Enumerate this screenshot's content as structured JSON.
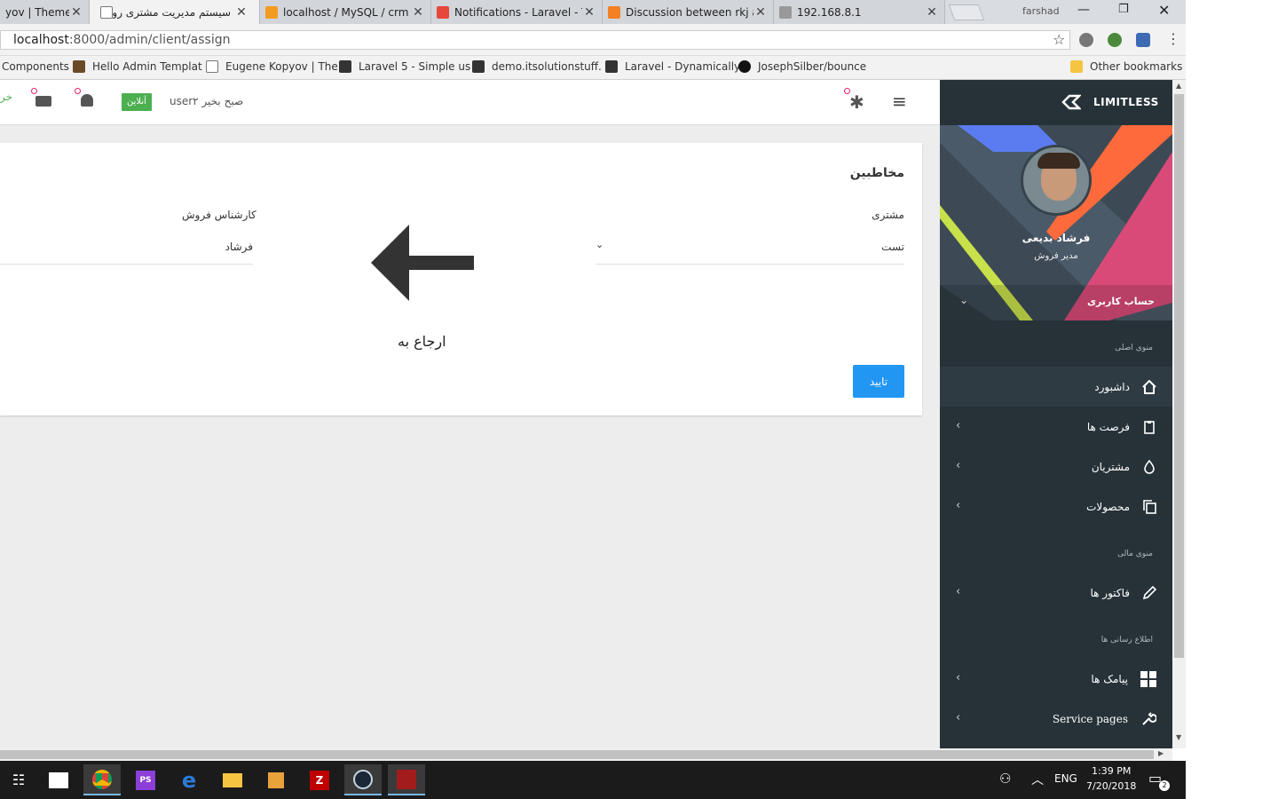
{
  "browser": {
    "tabs": [
      {
        "title": "yov | Theme"
      },
      {
        "title": "سیستم مدیریت مشتری روی"
      },
      {
        "title": "localhost / MySQL / crm"
      },
      {
        "title": "Notifications - Laravel - T"
      },
      {
        "title": "Discussion between rkj ar"
      },
      {
        "title": "192.168.8.1"
      }
    ],
    "profile_name": "farshad",
    "url_host": "localhost",
    "url_path": ":8000/admin/client/assign",
    "bookmarks": [
      "Components",
      "Hello Admin Templat",
      "Eugene Kopyov | The",
      "Laravel 5 - Simple us",
      "demo.itsolutionstuff.",
      "Laravel - Dynamically",
      "JosephSilber/bounce"
    ],
    "other_bookmarks": "Other bookmarks"
  },
  "topnav": {
    "greeting": "صبح بخیر user۲",
    "status_badge": "آنلاین",
    "edge_text": "خر"
  },
  "form": {
    "title": "مخاطبین",
    "customer_label": "مشتری",
    "customer_value": "تست",
    "sales_label": "کارشناس فروش",
    "sales_value": "فرشاد",
    "assign_text": "ارجاع به",
    "submit_label": "تایید"
  },
  "sidebar": {
    "brand": "LIMITLESS",
    "user_name": "فرشاد بدیعی",
    "user_role": "مدیر فروش",
    "account_label": "حساب کاربری",
    "section_main": "منوی اصلی",
    "section_finance": "منوی مالی",
    "section_info": "اطلاع رسانی ها",
    "items": [
      {
        "label": "داشبورد",
        "icon": "home-icon"
      },
      {
        "label": "فرصت ها",
        "icon": "clipboard-icon"
      },
      {
        "label": "مشتریان",
        "icon": "droplet-icon"
      },
      {
        "label": "محصولات",
        "icon": "copy-icon"
      },
      {
        "label": "فاکتور ها",
        "icon": "pencil-icon"
      },
      {
        "label": "پیامک ها",
        "icon": "grid-icon"
      },
      {
        "label": "Service pages",
        "icon": "wrench-icon"
      }
    ]
  },
  "taskbar": {
    "time": "1:39 PM",
    "date": "7/20/2018",
    "language": "ENG",
    "notification_count": "2"
  },
  "colors": {
    "sidebar_bg": "#263238",
    "primary_button": "#2196f3",
    "online_badge": "#4caf50"
  }
}
